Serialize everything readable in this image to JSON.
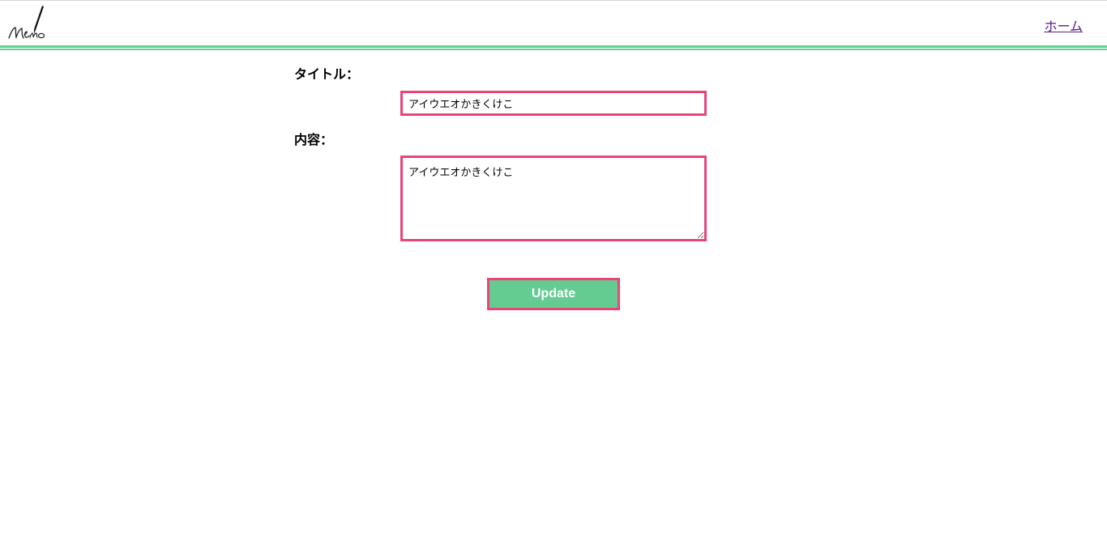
{
  "header": {
    "logo_text": "Memo",
    "home_link": "ホーム",
    "accent_color": "#5fcf93"
  },
  "form": {
    "title_label": "タイトル：",
    "title_value": "アイウエオかきくけこ",
    "content_label": "内容：",
    "content_value": "アイウエオかきくけこ",
    "submit_label": "Update",
    "border_color": "#e8457a",
    "button_color": "#64cc90"
  }
}
